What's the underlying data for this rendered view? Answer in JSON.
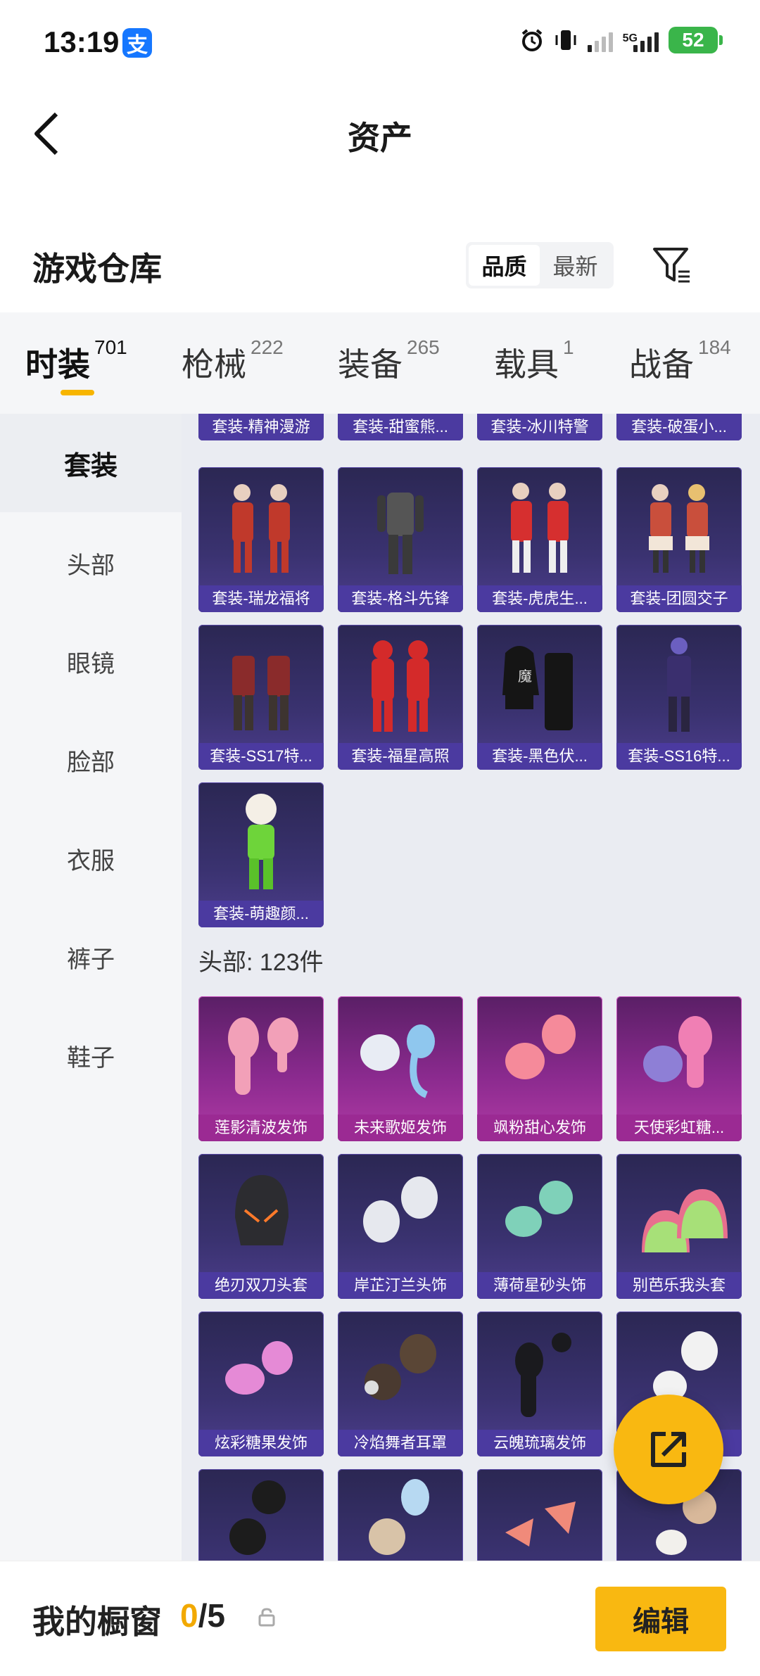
{
  "status_bar": {
    "time": "13:19",
    "app_badge": "支",
    "network": "5G",
    "battery": "52"
  },
  "header": {
    "title": "资产"
  },
  "warehouse": {
    "title": "游戏仓库",
    "sort_options": [
      "品质",
      "最新"
    ],
    "active_sort": "品质"
  },
  "tabs": [
    {
      "label": "时装",
      "count": "701",
      "active": true
    },
    {
      "label": "枪械",
      "count": "222",
      "active": false
    },
    {
      "label": "装备",
      "count": "265",
      "active": false
    },
    {
      "label": "载具",
      "count": "1",
      "active": false
    },
    {
      "label": "战备",
      "count": "184",
      "active": false
    }
  ],
  "sidebar": {
    "items": [
      {
        "label": "套装",
        "active": true
      },
      {
        "label": "头部",
        "active": false
      },
      {
        "label": "眼镜",
        "active": false
      },
      {
        "label": "脸部",
        "active": false
      },
      {
        "label": "衣服",
        "active": false
      },
      {
        "label": "裤子",
        "active": false
      },
      {
        "label": "鞋子",
        "active": false
      }
    ]
  },
  "suits": {
    "top_partial_row": [
      "套装-精神漫游",
      "套装-甜蜜熊...",
      "套装-冰川特警",
      "套装-破蛋小..."
    ],
    "items": [
      "套装-瑞龙福将",
      "套装-格斗先锋",
      "套装-虎虎生...",
      "套装-团圆交子",
      "套装-SS17特...",
      "套装-福星高照",
      "套装-黑色伏...",
      "套装-SS16特...",
      "套装-萌趣颜..."
    ]
  },
  "head_section": {
    "heading": "头部: 123件",
    "items": [
      "莲影清波发饰",
      "未来歌姬发饰",
      "飒粉甜心发饰",
      "天使彩虹糖...",
      "绝刃双刀头套",
      "岸芷汀兰头饰",
      "薄荷星砂头饰",
      "别芭乐我头套",
      "炫彩糖果发饰",
      "冷焰舞者耳罩",
      "云魄琉璃发饰",
      ""
    ]
  },
  "bottom_bar": {
    "label": "我的橱窗",
    "current": "0",
    "total": "/5",
    "edit_label": "编辑"
  },
  "colors": {
    "accent": "#f9b811",
    "card_purple": "#4b3aa0",
    "card_pink": "#9b2a93"
  }
}
